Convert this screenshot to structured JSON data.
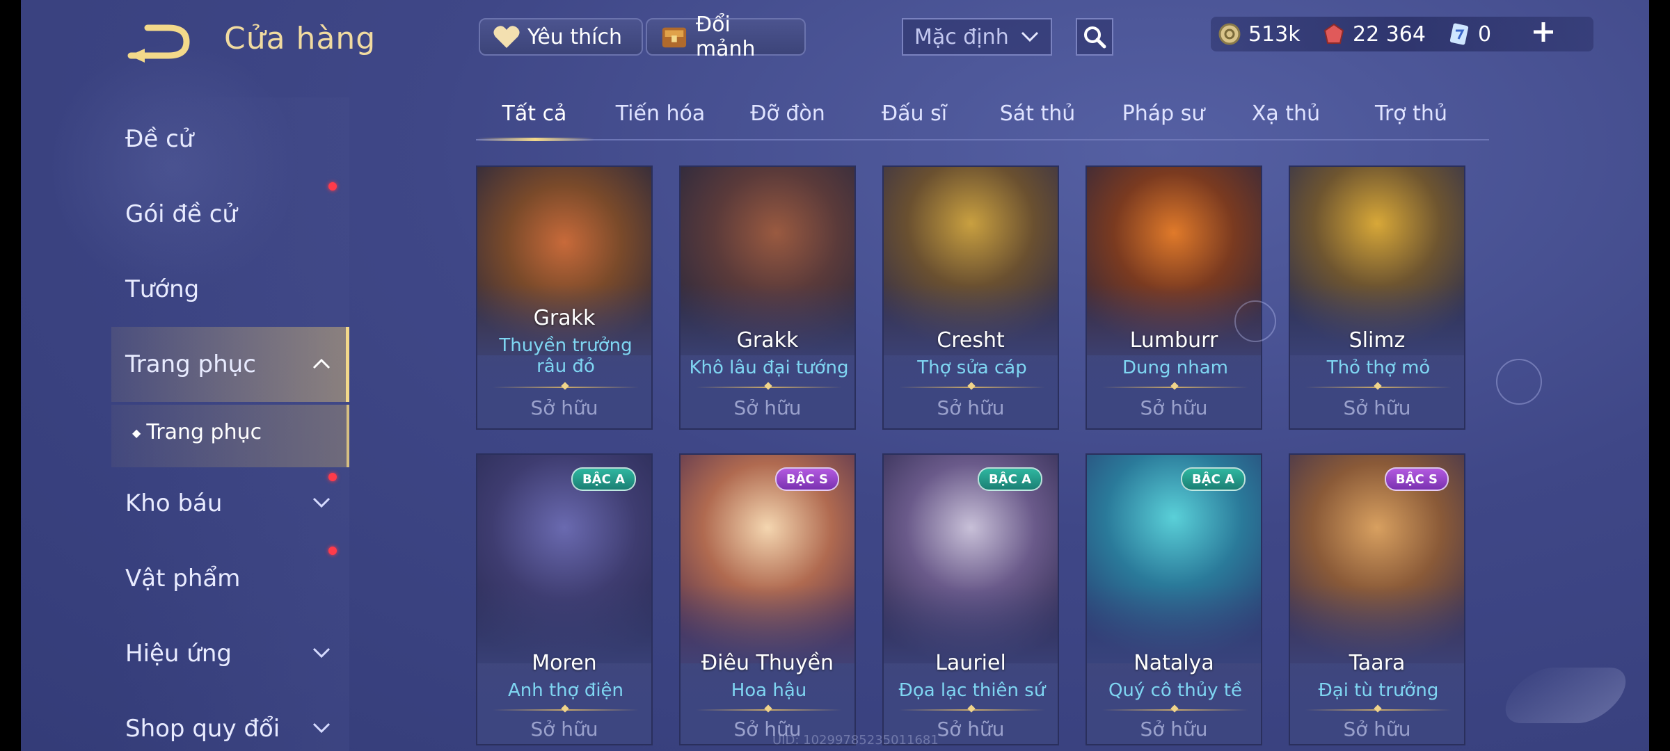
{
  "header": {
    "title": "Cửa hàng"
  },
  "sidebar": {
    "items": [
      {
        "label": "Đề cử",
        "has_dot": false,
        "chevron": ""
      },
      {
        "label": "Gói đề cử",
        "has_dot": true,
        "chevron": ""
      },
      {
        "label": "Tướng",
        "has_dot": false,
        "chevron": ""
      },
      {
        "label": "Trang phục",
        "has_dot": false,
        "chevron": "up",
        "active": true
      },
      {
        "label": "Kho báu",
        "has_dot": true,
        "chevron": "down"
      },
      {
        "label": "Vật phẩm",
        "has_dot": true,
        "chevron": ""
      },
      {
        "label": "Hiệu ứng",
        "has_dot": false,
        "chevron": "down"
      },
      {
        "label": "Shop quy đổi",
        "has_dot": false,
        "chevron": "down"
      }
    ],
    "subitem": {
      "label": "Trang phục"
    }
  },
  "topbar": {
    "favorites_label": "Yêu thích",
    "exchange_label": "Đổi mảnh",
    "sort_value": "Mặc định",
    "currencies": [
      {
        "icon": "gold-coin-icon",
        "value": "513k"
      },
      {
        "icon": "ruby-icon",
        "value": "22 364"
      },
      {
        "icon": "voucher-icon",
        "value": "0"
      }
    ]
  },
  "tabs": [
    "Tất cả",
    "Tiến hóa",
    "Đỡ đòn",
    "Đấu sĩ",
    "Sát thủ",
    "Pháp sư",
    "Xạ thủ",
    "Trợ thủ"
  ],
  "active_tab": "Tất cả",
  "cards": [
    {
      "hero": "Grakk",
      "skin": "Thuyền trưởng râu đỏ",
      "status": "Sở hữu",
      "badge": ""
    },
    {
      "hero": "Grakk",
      "skin": "Khô lâu đại tướng",
      "status": "Sở hữu",
      "badge": ""
    },
    {
      "hero": "Cresht",
      "skin": "Thợ sửa cáp",
      "status": "Sở hữu",
      "badge": ""
    },
    {
      "hero": "Lumburr",
      "skin": "Dung nham",
      "status": "Sở hữu",
      "badge": ""
    },
    {
      "hero": "Slimz",
      "skin": "Thỏ thợ mỏ",
      "status": "Sở hữu",
      "badge": ""
    },
    {
      "hero": "Moren",
      "skin": "Anh thợ điện",
      "status": "Sở hữu",
      "badge": "BẬC A"
    },
    {
      "hero": "Điêu Thuyền",
      "skin": "Hoa hậu",
      "status": "Sở hữu",
      "badge": "BẬC S"
    },
    {
      "hero": "Lauriel",
      "skin": "Đọa lạc thiên sứ",
      "status": "Sở hữu",
      "badge": "BẬC A"
    },
    {
      "hero": "Natalya",
      "skin": "Quý cô thủy tề",
      "status": "Sở hữu",
      "badge": "BẬC A"
    },
    {
      "hero": "Taara",
      "skin": "Đại tù trưởng",
      "status": "Sở hữu",
      "badge": "BẬC S"
    }
  ],
  "uid_text": "UID: 10299785235011681",
  "colors": {
    "accent_gold": "#f3d98a",
    "skin_name": "#7fd6f2",
    "notification_dot": "#ff3b4a",
    "badge_a": "#2fb7a0",
    "badge_s": "#b35ae0"
  }
}
